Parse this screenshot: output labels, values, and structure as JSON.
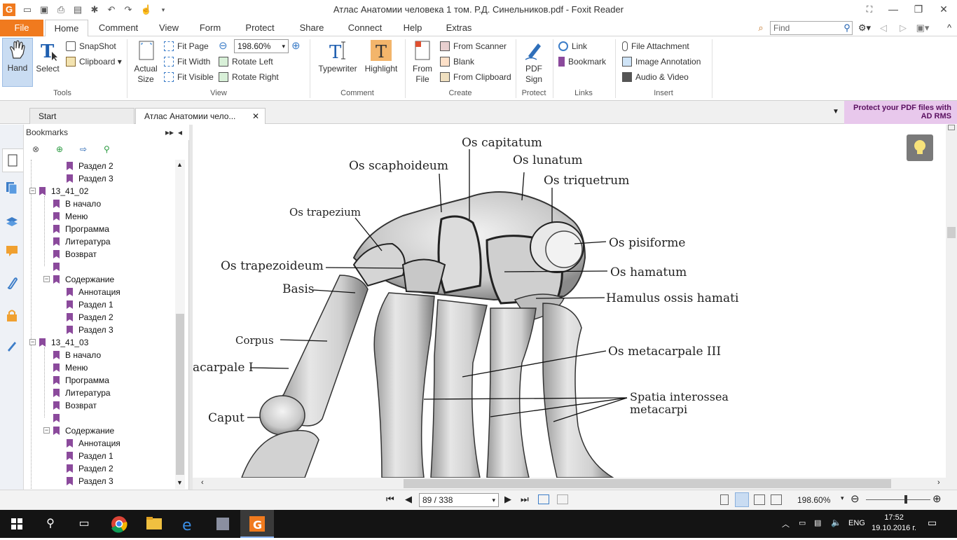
{
  "app": {
    "title": "Атлас Анатомии человека 1 том. Р.Д. Синельников.pdf - Foxit Reader",
    "window_controls": {
      "minimize": "—",
      "maximize": "❐",
      "close": "✕"
    }
  },
  "menu": {
    "file": "File",
    "tabs": [
      "Home",
      "Comment",
      "View",
      "Form",
      "Protect",
      "Share",
      "Connect",
      "Help",
      "Extras"
    ],
    "active": "Home",
    "find_placeholder": "Find"
  },
  "ribbon": {
    "tools": {
      "hand": "Hand",
      "select": "Select",
      "snapshot": "SnapShot",
      "clipboard": "Clipboard",
      "label": "Tools"
    },
    "view": {
      "actual_size_1": "Actual",
      "actual_size_2": "Size",
      "fit_page": "Fit Page",
      "fit_width": "Fit Width",
      "fit_visible": "Fit Visible",
      "zoom": "198.60%",
      "rotate_left": "Rotate Left",
      "rotate_right": "Rotate Right",
      "label": "View"
    },
    "comment": {
      "typewriter": "Typewriter",
      "highlight": "Highlight",
      "label": "Comment"
    },
    "create": {
      "from_file_1": "From",
      "from_file_2": "File",
      "from_scanner": "From Scanner",
      "blank": "Blank",
      "from_clipboard": "From Clipboard",
      "label": "Create"
    },
    "protect": {
      "pdf_sign_1": "PDF",
      "pdf_sign_2": "Sign",
      "label": "Protect"
    },
    "links": {
      "link": "Link",
      "bookmark": "Bookmark",
      "label": "Links"
    },
    "insert": {
      "file_attachment": "File Attachment",
      "image_annotation": "Image Annotation",
      "audio_video": "Audio & Video",
      "label": "Insert"
    }
  },
  "doctabs": {
    "start": "Start",
    "document": "Атлас Анатомии чело...",
    "ad": "Protect your PDF files with AD RMS"
  },
  "bookmarks": {
    "header": "Bookmarks",
    "items": [
      {
        "label": "Раздел 2"
      },
      {
        "label": "Раздел 3"
      },
      {
        "label": "13_41_02"
      },
      {
        "label": "В начало"
      },
      {
        "label": "Меню"
      },
      {
        "label": "Программа"
      },
      {
        "label": "Литература"
      },
      {
        "label": "Возврат"
      },
      {
        "label": ""
      },
      {
        "label": "Содержание"
      },
      {
        "label": "Аннотация"
      },
      {
        "label": "Раздел 1"
      },
      {
        "label": "Раздел 2"
      },
      {
        "label": "Раздел 3"
      },
      {
        "label": "13_41_03"
      },
      {
        "label": "В начало"
      },
      {
        "label": "Меню"
      },
      {
        "label": "Программа"
      },
      {
        "label": "Литература"
      },
      {
        "label": "Возврат"
      },
      {
        "label": ""
      },
      {
        "label": "Содержание"
      },
      {
        "label": "Аннотация"
      },
      {
        "label": "Раздел 1"
      },
      {
        "label": "Раздел 2"
      },
      {
        "label": "Раздел 3"
      }
    ]
  },
  "figure_labels": {
    "capitatum": "Os capitatum",
    "scaphoideum": "Os scaphoideum",
    "lunatum": "Os lunatum",
    "triquetrum": "Os triquetrum",
    "trapezium": "Os trapezium",
    "pisiforme": "Os pisiforme",
    "trapezoideum": "Os trapezoideum",
    "hamatum": "Os hamatum",
    "basis": "Basis",
    "hamulus": "Hamulus ossis hamati",
    "corpus": "Corpus",
    "metacarpale3": "Os metacarpale III",
    "metacarpale1": "acarpale I",
    "spatia1": "Spatia  interossea",
    "spatia2": "metacarpi",
    "caput": "Caput"
  },
  "status": {
    "page": "89 / 338",
    "zoom": "198.60%"
  },
  "taskbar": {
    "lang": "ENG",
    "time": "17:52",
    "date": "19.10.2016 г."
  }
}
